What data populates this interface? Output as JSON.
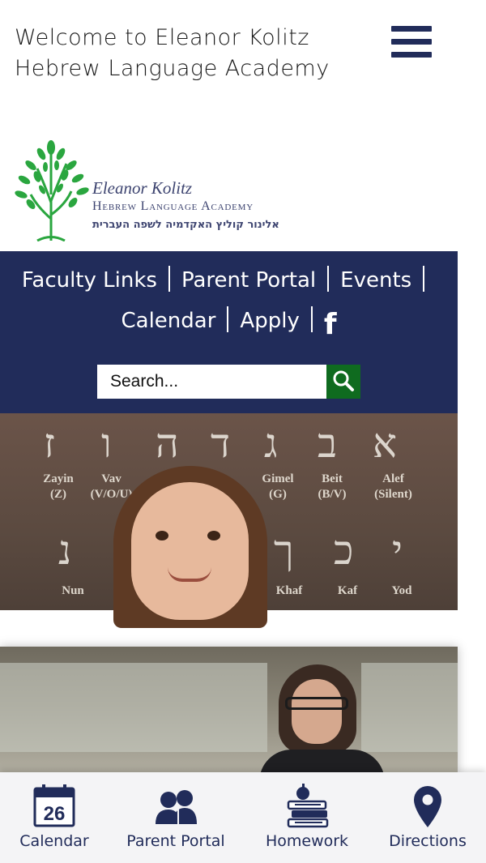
{
  "header": {
    "title_line1": "Welcome to Eleanor Kolitz",
    "title_line2": "Hebrew Language Academy"
  },
  "logo": {
    "name": "Eleanor Kolitz",
    "subtitle": "Hebrew Language Academy",
    "hebrew": "אלינור קוליץ האקדמיה לשפה העברית"
  },
  "nav": {
    "faculty_links": "Faculty Links",
    "parent_portal": "Parent Portal",
    "events": "Events",
    "calendar": "Calendar",
    "apply": "Apply"
  },
  "search": {
    "placeholder": "Search..."
  },
  "hero1": {
    "letters": [
      "ז",
      "ו",
      "ה",
      "ד",
      "ג",
      "ב",
      "א"
    ],
    "captions": [
      "Zayin\n(Z)",
      "Vav\n(V/O/U)",
      "Gimel\n(G)",
      "Beit\n(B/V)",
      "Alef\n(Silent)"
    ],
    "letters_row2": [
      "נ",
      "ך",
      "כ",
      "י"
    ],
    "captions_row2": [
      "Nun",
      "Khaf",
      "Kaf",
      "Yod"
    ]
  },
  "tabbar": {
    "calendar_label": "Calendar",
    "calendar_day": "26",
    "parent_portal_label": "Parent Portal",
    "homework_label": "Homework",
    "directions_label": "Directions"
  },
  "colors": {
    "navy": "#212c5a",
    "search_green": "#0f6b1f",
    "logo_green": "#2aa63f"
  }
}
